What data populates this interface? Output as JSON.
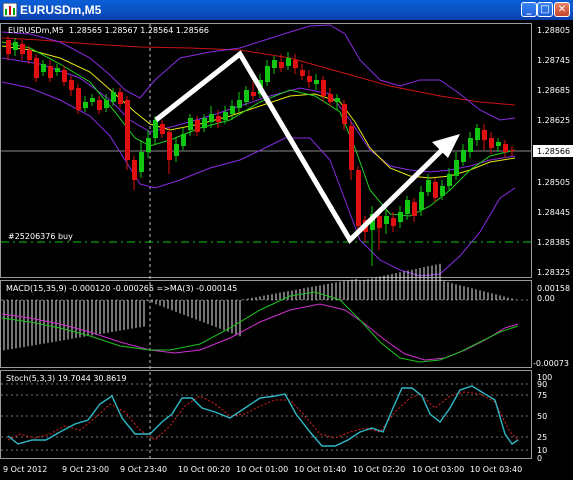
{
  "window": {
    "title": "EURUSDm,M5"
  },
  "chart": {
    "symbol_label": "EURUSDm,M5",
    "ohlc_label": "1.28565 1.28567 1.28564 1.28566",
    "order_label": "#25206376 buy",
    "current_price": "1.28566",
    "price_axis": [
      "1.28805",
      "1.28745",
      "1.28685",
      "1.28625",
      "1.28566",
      "1.28505",
      "1.28445",
      "1.28385",
      "1.28325"
    ]
  },
  "macd": {
    "label": "MACD(15,35,9) -0.000120 -0.000265 =>MA(3) -0.000145",
    "axis": [
      "0.00158",
      "0.00",
      " -0.00073"
    ]
  },
  "stoch": {
    "label": "Stoch(5,3,3) 19.7044 30.8619",
    "axis": [
      "100",
      "90",
      "75",
      "50",
      "25",
      "10",
      "0"
    ]
  },
  "time_axis": [
    "9 Oct 2012",
    "9 Oct 23:00",
    "9 Oct 23:40",
    "10 Oct 00:20",
    "10 Oct 01:00",
    "10 Oct 01:40",
    "10 Oct 02:20",
    "10 Oct 03:00",
    "10 Oct 03:40"
  ],
  "colors": {
    "bull": "#11c711",
    "bear": "#e01010",
    "ma_slow": "#c81414",
    "ma_fast": "#e8e810",
    "ma_green": "#20d020",
    "bands": "#8a2be2",
    "macd_main": "#20c020",
    "macd_signal": "#d030d0",
    "stoch_main": "#30b8c8",
    "stoch_signal": "#e02020"
  }
}
